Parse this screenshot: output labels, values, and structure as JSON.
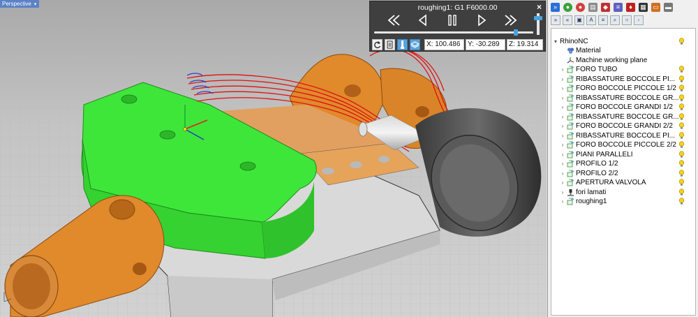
{
  "viewport": {
    "label": "Perspective",
    "menu_arrow": "▾"
  },
  "simulation": {
    "title": "roughing1: G1 F6000.00",
    "close_glyph": "×",
    "x_readout": "X: 100.486",
    "y_readout": "Y: -30.289",
    "z_readout": "Z: 19.314",
    "progress_fraction": 0.9,
    "speed_fraction": 0.15
  },
  "tree": {
    "root_label": "RhinoNC",
    "items": [
      {
        "label": "Material",
        "icon": "material-icon",
        "expandable": false,
        "bulb": false
      },
      {
        "label": "Machine working plane",
        "icon": "working-plane-icon",
        "expandable": false,
        "bulb": false
      },
      {
        "label": "FORO TUBO",
        "icon": "operation-icon",
        "expandable": true,
        "bulb": true
      },
      {
        "label": "RIBASSATURE BOCCOLE PI...",
        "icon": "operation-icon",
        "expandable": true,
        "bulb": true
      },
      {
        "label": "FORO BOCCOLE PICCOLE 1/2",
        "icon": "operation-icon",
        "expandable": true,
        "bulb": true
      },
      {
        "label": "RIBASSATURE BOCCOLE GR...",
        "icon": "operation-icon",
        "expandable": true,
        "bulb": true
      },
      {
        "label": "FORO BOCCOLE GRANDI 1/2",
        "icon": "operation-icon",
        "expandable": true,
        "bulb": true
      },
      {
        "label": "RIBASSATURE BOCCOLE GR...",
        "icon": "operation-icon",
        "expandable": true,
        "bulb": true
      },
      {
        "label": "FORO BOCCOLE GRANDI 2/2",
        "icon": "operation-icon",
        "expandable": true,
        "bulb": true
      },
      {
        "label": "RIBASSATURE BOCCOLE PI...",
        "icon": "operation-icon",
        "expandable": true,
        "bulb": true
      },
      {
        "label": "FORO BOCCOLE PICCOLE 2/2",
        "icon": "operation-icon",
        "expandable": true,
        "bulb": true
      },
      {
        "label": "PIANI PARALLELI",
        "icon": "operation-icon",
        "expandable": true,
        "bulb": true
      },
      {
        "label": "PROFILO 1/2",
        "icon": "operation-icon",
        "expandable": true,
        "bulb": true
      },
      {
        "label": "PROFILO 2/2",
        "icon": "operation-icon",
        "expandable": true,
        "bulb": true
      },
      {
        "label": "APERTURA VALVOLA",
        "icon": "operation-icon",
        "expandable": true,
        "bulb": true
      },
      {
        "label": "fori lamati",
        "icon": "drill-icon",
        "expandable": true,
        "bulb": true
      },
      {
        "label": "roughing1",
        "icon": "operation-icon",
        "expandable": true,
        "bulb": true
      }
    ]
  },
  "colors": {
    "part_green": "#3ee63a",
    "part_orange": "#e08a2c",
    "toolpath_red": "#e01010",
    "sim_panel": "#3f3f3f",
    "accent_blue": "#4aa3e0"
  }
}
